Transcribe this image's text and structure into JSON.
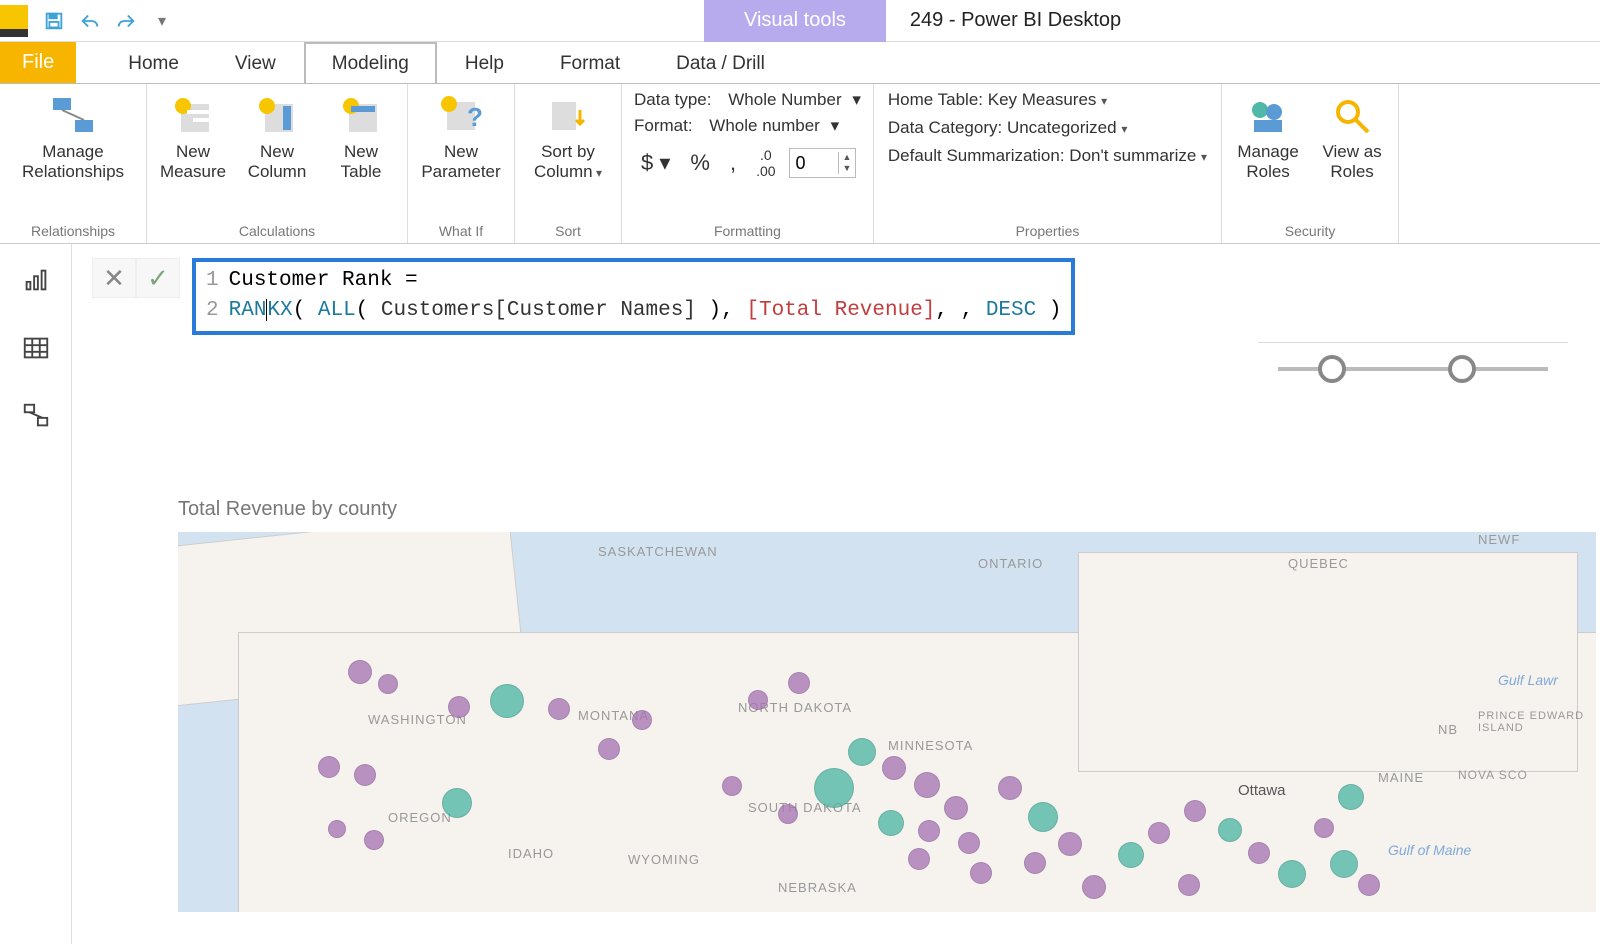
{
  "titlebar": {
    "visual_tools": "Visual tools",
    "doc_title": "249 - Power BI Desktop"
  },
  "tabs": {
    "file": "File",
    "home": "Home",
    "view": "View",
    "modeling": "Modeling",
    "help": "Help",
    "format": "Format",
    "data_drill": "Data / Drill"
  },
  "ribbon": {
    "relationships": {
      "manage": "Manage Relationships",
      "group": "Relationships"
    },
    "calculations": {
      "new_measure": "New Measure",
      "new_column": "New Column",
      "new_table": "New Table",
      "group": "Calculations"
    },
    "whatif": {
      "new_parameter": "New Parameter",
      "group": "What If"
    },
    "sort": {
      "sort_by_column": "Sort by Column",
      "group": "Sort"
    },
    "formatting": {
      "data_type_label": "Data type:",
      "data_type_value": "Whole Number",
      "format_label": "Format:",
      "format_value": "Whole number",
      "decimals": "0",
      "group": "Formatting"
    },
    "properties": {
      "home_table_label": "Home Table:",
      "home_table_value": "Key Measures",
      "data_category_label": "Data Category:",
      "data_category_value": "Uncategorized",
      "default_sum_label": "Default Summarization:",
      "default_sum_value": "Don't summarize",
      "group": "Properties"
    },
    "security": {
      "manage_roles": "Manage Roles",
      "view_as_roles": "View as Roles",
      "group": "Security"
    }
  },
  "formula": {
    "line1_name": "Customer Rank",
    "line1_eq": " = ",
    "line2_fn": "RANKX",
    "line2_paren1": "( ",
    "line2_all": "ALL",
    "line2_paren2": "( ",
    "line2_col": "Customers[Customer Names]",
    "line2_paren2c": " ), ",
    "line2_meas": "[Total Revenue]",
    "line2_sep": ", , ",
    "line2_desc": "DESC",
    "line2_paren1c": " )"
  },
  "visual": {
    "title": "Total Revenue by county"
  },
  "map_labels": {
    "sask": "SASKATCHEWAN",
    "ontario": "ONTARIO",
    "quebec": "QUEBEC",
    "wa": "WASHINGTON",
    "mt": "MONTANA",
    "nd": "NORTH DAKOTA",
    "mn": "MINNESOTA",
    "or": "OREGON",
    "id": "IDAHO",
    "wy": "WYOMING",
    "sd": "SOUTH DAKOTA",
    "ne": "NEBRASKA",
    "nb": "NB",
    "pei": "PRINCE EDWARD ISLAND",
    "ns": "NOVA SCO",
    "maine": "MAINE",
    "ottawa": "Ottawa",
    "gulf_lawr": "Gulf Lawr",
    "gulf_maine": "Gulf of Maine",
    "newf": "NEWF"
  },
  "chart_data": {
    "type": "scatter",
    "title": "Total Revenue by county",
    "note": "Bubble map over North America; size ≈ Total Revenue per county; color distinguishes two groups (purple, teal). Exact values not labeled in source.",
    "series": [
      {
        "name": "purple",
        "color": "#a876b5"
      },
      {
        "name": "teal",
        "color": "#4fb8a6"
      }
    ]
  }
}
